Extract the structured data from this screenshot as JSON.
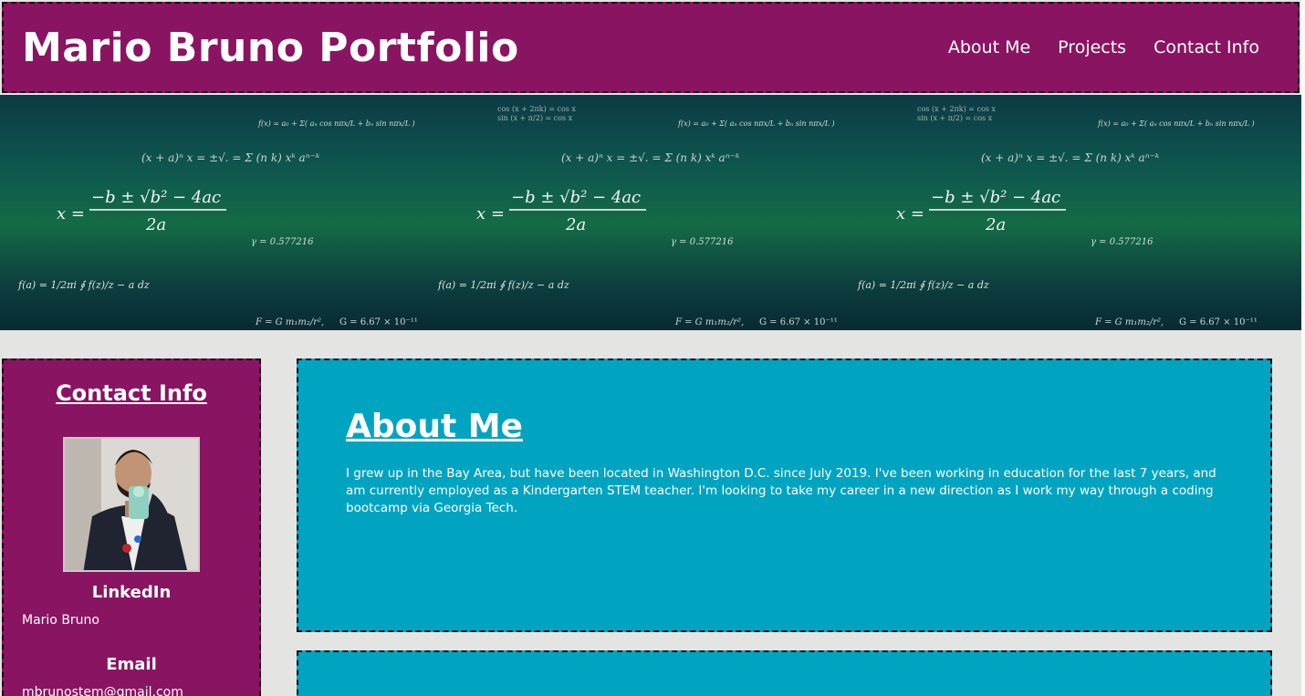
{
  "header": {
    "title": "Mario Bruno Portfolio",
    "nav": [
      "About Me",
      "Projects",
      "Contact Info"
    ]
  },
  "hero": {
    "formulas": {
      "quadratic_left": "x =",
      "quadratic_num": "−b ± √b² − 4ac",
      "quadratic_den": "2a",
      "cauchy": "f(a) = 1/2πi ∮ f(z)/z − a dz",
      "fourier": "f(x) = a₀ + Σ( aₙ cos nπx/L + bₙ sin nπx/L )",
      "binomial": "(x + a)ⁿ x = ±√. = Σ (n k) xᵏ aⁿ⁻ᵏ",
      "gravity": "F = G m₁m₂/r²,",
      "gconst": "G = 6.67 × 10⁻¹¹",
      "euler": "γ = 0.577216",
      "cos1": "cos (x + 2πk) = cos x",
      "sin1": "sin (x + π/2) = cos x"
    }
  },
  "sidebar": {
    "heading": "Contact Info",
    "linkedin_label": "LinkedIn",
    "linkedin_value": "Mario Bruno",
    "email_label": "Email",
    "email_value": "mbrunostem@gmail.com"
  },
  "about": {
    "title": "About Me",
    "text": "I grew up in the Bay Area, but have been located in Washington D.C. since July 2019. I've been working in education for the last 7 years, and am currently employed as a Kindergarten STEM teacher. I'm looking to take my career in a new direction as I work my way through a coding bootcamp via Georgia Tech."
  },
  "colors": {
    "header_bg": "#891461",
    "card_bg": "#00a4c1",
    "page_bg": "#e4e4e2"
  }
}
